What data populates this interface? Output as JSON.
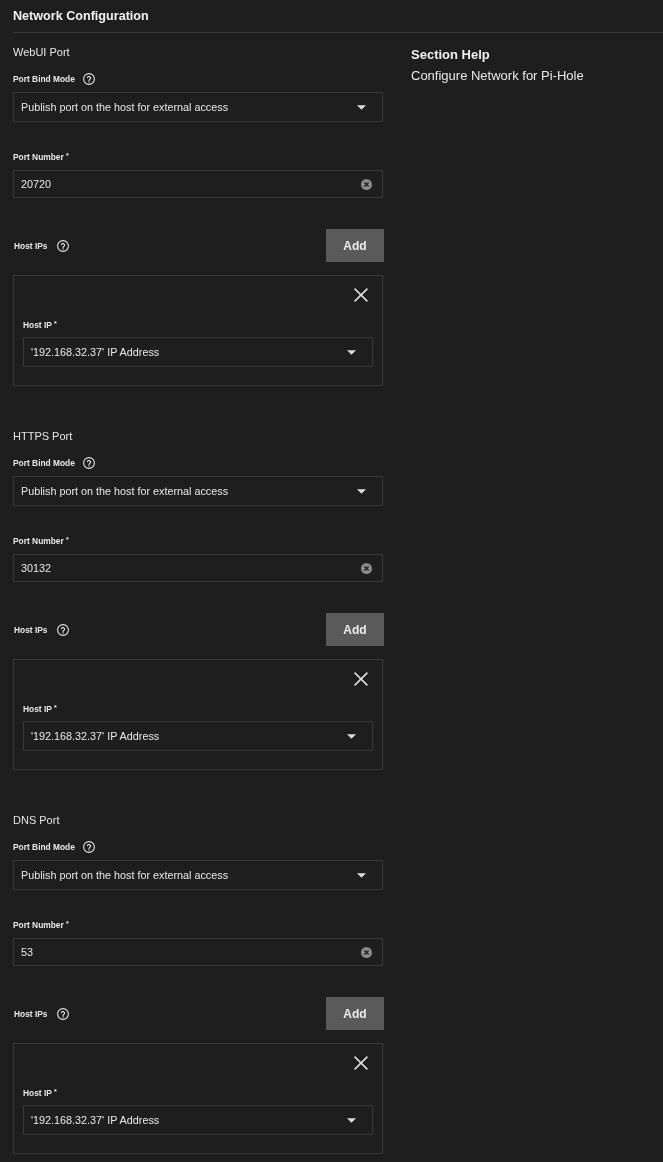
{
  "header": {
    "title": "Network Configuration"
  },
  "help": {
    "title": "Section Help",
    "text": "Configure Network for Pi-Hole"
  },
  "sections": [
    {
      "title": "WebUI Port",
      "bind_mode": {
        "label": "Port Bind Mode",
        "value": "Publish port on the host for external access"
      },
      "port_number": {
        "label": "Port Number $^{*}$",
        "value": "20720"
      },
      "host_ips": {
        "label": "Host IPs",
        "add_button": "Add",
        "entries": [
          {
            "label": "Host IP $^{*}$",
            "value": "'192.168.32.37' IP Address"
          }
        ]
      }
    },
    {
      "title": "HTTPS Port",
      "bind_mode": {
        "label": "Port Bind Mode",
        "value": "Publish port on the host for external access"
      },
      "port_number": {
        "label": "Port Number $^{*}$",
        "value": "30132"
      },
      "host_ips": {
        "label": "Host IPs",
        "add_button": "Add",
        "entries": [
          {
            "label": "Host IP $^{*}$",
            "value": "'192.168.32.37' IP Address"
          }
        ]
      }
    },
    {
      "title": "DNS Port",
      "bind_mode": {
        "label": "Port Bind Mode",
        "value": "Publish port on the host for external access"
      },
      "port_number": {
        "label": "Port Number $^{*}$",
        "value": "53"
      },
      "host_ips": {
        "label": "Host IPs",
        "add_button": "Add",
        "entries": [
          {
            "label": "Host IP $^{*}$",
            "value": "'192.168.32.37' IP Address"
          }
        ]
      }
    }
  ]
}
